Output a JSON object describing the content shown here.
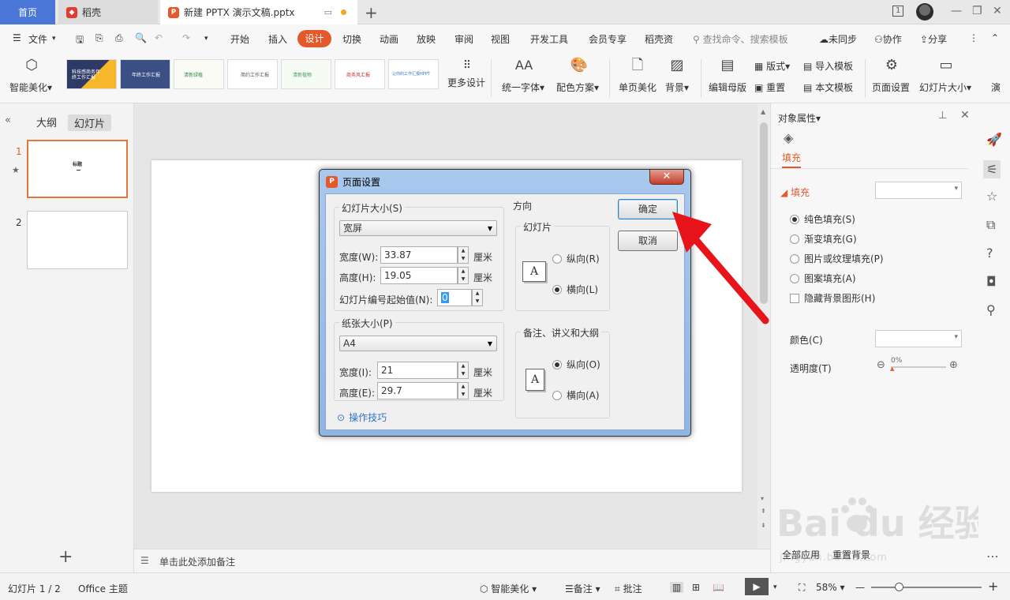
{
  "tabs": {
    "home": "首页",
    "daoke": "稻壳",
    "doc": "新建 PPTX 演示文稿.pptx"
  },
  "window": {
    "badge": "1"
  },
  "menu": {
    "file": "文件",
    "items": [
      "开始",
      "插入",
      "设计",
      "切换",
      "动画",
      "放映",
      "审阅",
      "视图",
      "开发工具",
      "会员专享",
      "稻壳资"
    ],
    "active": "设计",
    "search": "查找命令、搜索模板",
    "sync": "未同步",
    "collab": "协作",
    "share": "分享"
  },
  "ribbon": {
    "smart_beautify": "智能美化",
    "more_design": "更多设计",
    "unify_font": "统一字体",
    "color_scheme": "配色方案",
    "single_beautify": "单页美化",
    "background": "背景",
    "edit_master": "编辑母版",
    "layout": "版式",
    "reset": "重置",
    "import_template": "导入模板",
    "text_template": "本文模板",
    "page_setup": "页面设置",
    "slide_size": "幻灯片大小",
    "overflow": "演",
    "thumb_texts": [
      "科技感商务年终工作汇报",
      "年终工作汇报",
      "清新绿植",
      "简约工作汇报",
      "清新植物",
      "商务风汇报",
      "让你的工作汇报HPPT"
    ]
  },
  "left_panel": {
    "outline_tab": "大纲",
    "slides_tab": "幻灯片",
    "slide1_num": "1",
    "slide2_num": "2",
    "slide1_title": "标题"
  },
  "notes_placeholder": "单击此处添加备注",
  "right_panel": {
    "title": "对象属性",
    "fill_tab": "填充",
    "fill_section": "填充",
    "options": [
      "纯色填充(S)",
      "渐变填充(G)",
      "图片或纹理填充(P)",
      "图案填充(A)"
    ],
    "hide_bg": "隐藏背景图形(H)",
    "color_label": "颜色(C)",
    "transparency_label": "透明度(T)",
    "transparency_value": "0%",
    "apply_all": "全部应用",
    "reset_bg": "重置背景"
  },
  "status": {
    "slide_count": "幻灯片 1 / 2",
    "theme": "Office 主题",
    "smart": "智能美化",
    "notes": "备注",
    "comment": "批注",
    "zoom": "58%"
  },
  "dialog": {
    "title": "页面设置",
    "slide_size_group": "幻灯片大小(S)",
    "slide_size_value": "宽屏",
    "width_label": "宽度(W):",
    "width_value": "33.87",
    "height_label": "高度(H):",
    "height_value": "19.05",
    "unit": "厘米",
    "start_num_label": "幻灯片编号起始值(N):",
    "start_num_value": "0",
    "paper_group": "纸张大小(P)",
    "paper_value": "A4",
    "paper_width_label": "宽度(I):",
    "paper_width_value": "21",
    "paper_height_label": "高度(E):",
    "paper_height_value": "29.7",
    "orientation_group": "方向",
    "slide_orient_group": "幻灯片",
    "portrait_r": "纵向(R)",
    "landscape_l": "横向(L)",
    "notes_group": "备注、讲义和大纲",
    "portrait_o": "纵向(O)",
    "landscape_a": "横向(A)",
    "tips": "操作技巧",
    "ok": "确定",
    "cancel": "取消",
    "letter_a": "A"
  },
  "watermark": {
    "brand": "Bai du 经验",
    "url": "jingyan.baidu.com"
  },
  "colors": {
    "accent": "#e4592b",
    "home_tab": "#4a76d8",
    "arrow": "#e8141b"
  }
}
